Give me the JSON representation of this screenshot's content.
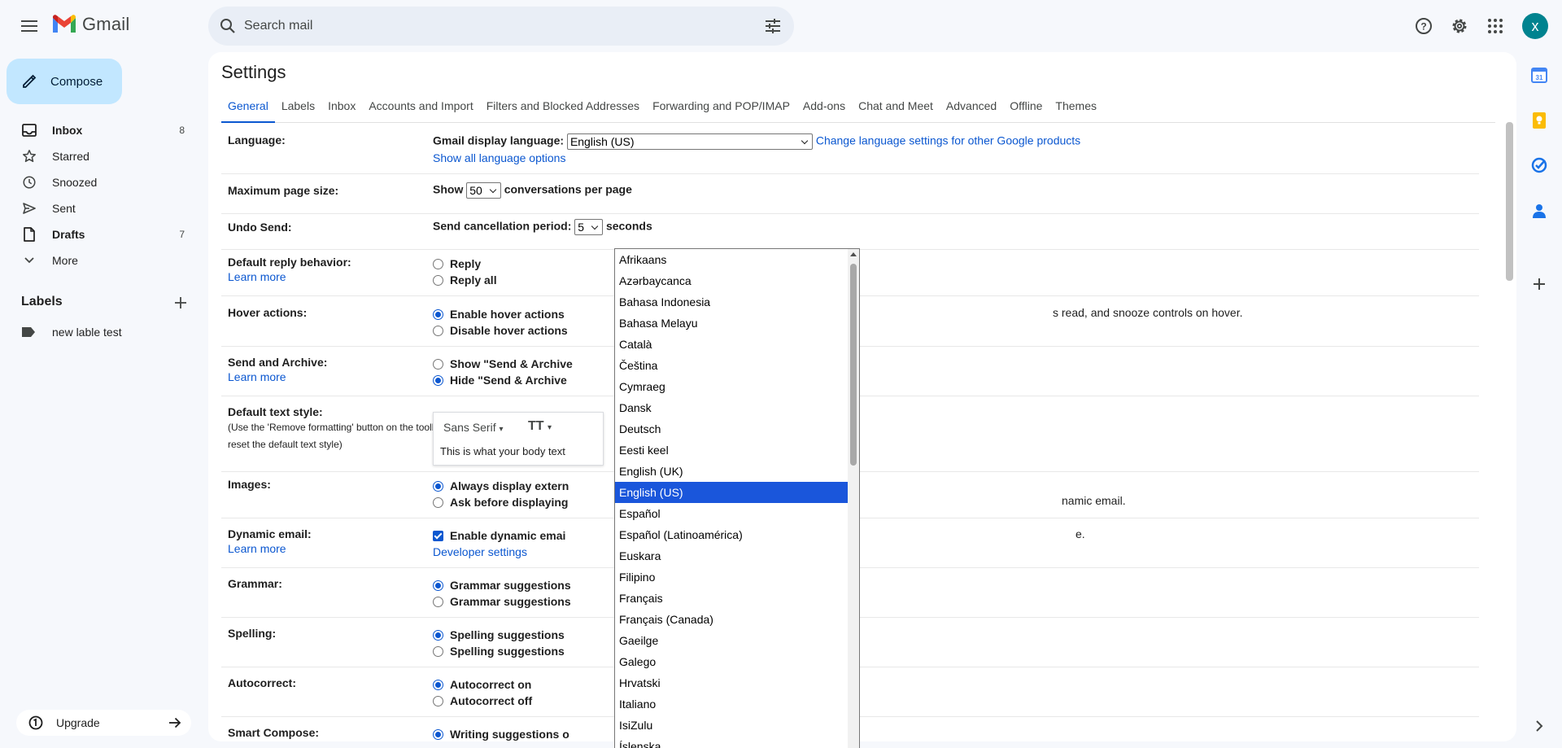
{
  "header": {
    "app_name": "Gmail",
    "search_placeholder": "Search mail",
    "avatar_letter": "x"
  },
  "nav": {
    "compose": "Compose",
    "items": [
      {
        "label": "Inbox",
        "count": "8",
        "icon": "inbox-icon",
        "bold": true
      },
      {
        "label": "Starred",
        "count": "",
        "icon": "star-icon",
        "bold": false
      },
      {
        "label": "Snoozed",
        "count": "",
        "icon": "clock-icon",
        "bold": false
      },
      {
        "label": "Sent",
        "count": "",
        "icon": "send-icon",
        "bold": false
      },
      {
        "label": "Drafts",
        "count": "7",
        "icon": "draft-icon",
        "bold": true
      },
      {
        "label": "More",
        "count": "",
        "icon": "chevron-down-icon",
        "bold": false
      }
    ],
    "labels_heading": "Labels",
    "labels": [
      "new lable test"
    ],
    "upgrade": "Upgrade"
  },
  "settings": {
    "title": "Settings",
    "tabs": [
      "General",
      "Labels",
      "Inbox",
      "Accounts and Import",
      "Filters and Blocked Addresses",
      "Forwarding and POP/IMAP",
      "Add-ons",
      "Chat and Meet",
      "Advanced",
      "Offline",
      "Themes"
    ],
    "learn_more": "Learn more",
    "language": {
      "label": "Language:",
      "display_label": "Gmail display language:",
      "selected": "English (US)",
      "change_link": "Change language settings for other Google products",
      "show_all": "Show all language options"
    },
    "page_size": {
      "label": "Maximum page size:",
      "show": "Show",
      "value": "50",
      "suffix": "conversations per page"
    },
    "undo_send": {
      "label": "Undo Send:",
      "prefix": "Send cancellation period:",
      "value": "5",
      "suffix": "seconds"
    },
    "reply": {
      "label": "Default reply behavior:",
      "opt1": "Reply",
      "opt2": "Reply all"
    },
    "hover": {
      "label": "Hover actions:",
      "opt1": "Enable hover actions",
      "opt1_tail": "s read, and snooze controls on hover.",
      "opt2": "Disable hover actions"
    },
    "send_archive": {
      "label": "Send and Archive:",
      "opt1": "Show \"Send & Archive",
      "opt2": "Hide \"Send & Archive"
    },
    "text_style": {
      "label": "Default text style:",
      "sub": "(Use the 'Remove formatting' button on the toolbar to reset the default text style)",
      "font": "Sans Serif",
      "sample": "This is what your body text"
    },
    "images": {
      "label": "Images:",
      "opt1": "Always display extern",
      "opt2": "Ask before displaying",
      "opt2_tail": "namic email."
    },
    "dynamic": {
      "label": "Dynamic email:",
      "opt1": "Enable dynamic emai",
      "opt1_tail": "e.",
      "dev": "Developer settings"
    },
    "grammar": {
      "label": "Grammar:",
      "opt1": "Grammar suggestions",
      "opt2": "Grammar suggestions"
    },
    "spelling": {
      "label": "Spelling:",
      "opt1": "Spelling suggestions",
      "opt2": "Spelling suggestions"
    },
    "autocorrect": {
      "label": "Autocorrect:",
      "opt1": "Autocorrect on",
      "opt2": "Autocorrect off"
    },
    "smart_compose": {
      "label": "Smart Compose:",
      "opt1": "Writing suggestions o"
    }
  },
  "language_dropdown": {
    "selected_index": 11,
    "options": [
      "Afrikaans",
      "Azərbaycanca",
      "Bahasa Indonesia",
      "Bahasa Melayu",
      "Català",
      "Čeština",
      "Cymraeg",
      "Dansk",
      "Deutsch",
      "Eesti keel",
      "English (UK)",
      "English (US)",
      "Español",
      "Español (Latinoamérica)",
      "Euskara",
      "Filipino",
      "Français",
      "Français (Canada)",
      "Gaeilge",
      "Galego",
      "Hrvatski",
      "Italiano",
      "IsiZulu",
      "Íslenska"
    ]
  },
  "colors": {
    "accent": "#0b57d0",
    "compose_bg": "#c2e7ff",
    "dropdown_highlight": "#1a56db"
  }
}
